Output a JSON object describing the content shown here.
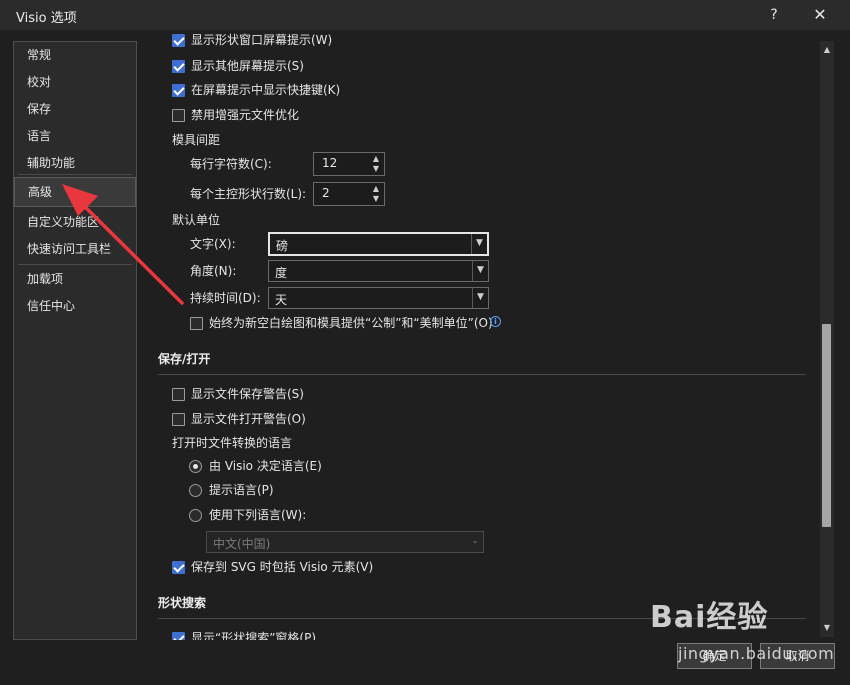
{
  "window": {
    "title": "Visio 选项"
  },
  "titlebar": {
    "help": "?",
    "close": "✕"
  },
  "sidebar": {
    "items": [
      {
        "label": "常规"
      },
      {
        "label": "校对"
      },
      {
        "label": "保存"
      },
      {
        "label": "语言"
      },
      {
        "label": "辅助功能"
      },
      {
        "label": "高级",
        "selected": true
      },
      {
        "label": "自定义功能区"
      },
      {
        "label": "快速访问工具栏"
      },
      {
        "label": "加载项"
      },
      {
        "label": "信任中心"
      }
    ]
  },
  "display": {
    "partial_top": "显示形状窗口屏幕提示(W)",
    "show_other_tips": "显示其他屏幕提示(S)",
    "show_shortcut_keys": "在屏幕提示中显示快捷键(K)",
    "disable_emf": "禁用增强元文件优化",
    "stencil_spacing_label": "模具间距",
    "chars_per_row_label": "每行字符数(C):",
    "chars_per_row_value": "12",
    "master_rows_label": "每个主控形状行数(L):",
    "master_rows_value": "2",
    "default_units_label": "默认单位",
    "text_label": "文字(X):",
    "text_value": "磅",
    "angle_label": "角度(N):",
    "angle_value": "度",
    "duration_label": "持续时间(D):",
    "duration_value": "天",
    "always_provide_units": "始终为新空白绘图和模具提供“公制”和“美制单位”(O)"
  },
  "save_open": {
    "heading": "保存/打开",
    "show_save_warning": "显示文件保存警告(S)",
    "show_open_warning": "显示文件打开警告(O)",
    "lang_label": "打开时文件转换的语言",
    "radio_visio": "由 Visio 决定语言(E)",
    "radio_prompt": "提示语言(P)",
    "radio_use": "使用下列语言(W):",
    "language_value": "中文(中国)",
    "include_visio_elements": "保存到 SVG 时包括 Visio 元素(V)"
  },
  "shape_search": {
    "heading": "形状搜索",
    "partial_bottom": "显示“形状搜索”窗格(P)"
  },
  "footer": {
    "ok": "确定",
    "cancel": "取消"
  },
  "watermark": {
    "brand": "Bai经验",
    "url": "jingyan.baidu.com"
  },
  "colors": {
    "accent": "#3f6fd1",
    "arrow": "#e8383d",
    "background": "#1f1f1f"
  }
}
